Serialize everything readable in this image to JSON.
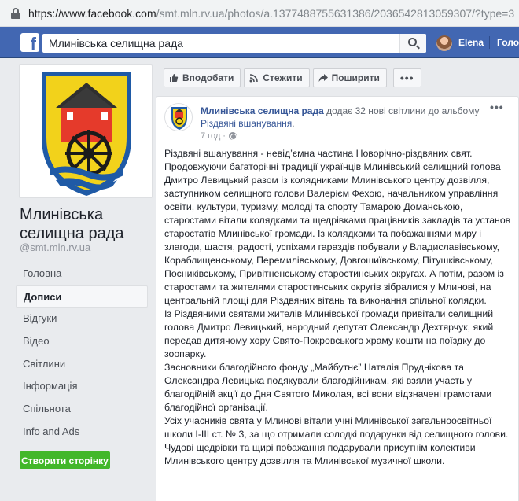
{
  "browser": {
    "url_main": "https://www.facebook.com",
    "url_rest": "/smt.mln.rv.ua/photos/a.1377488755631386/2036542813059307/?type=3"
  },
  "header": {
    "logo": "f",
    "search_value": "Млинівська селищна рада",
    "user_name": "Elena",
    "home_label": "Головна"
  },
  "page": {
    "name": "Млинівська селищна рада",
    "handle": "@smt.mln.rv.ua"
  },
  "nav": [
    {
      "label": "Головна",
      "active": false
    },
    {
      "label": "Дописи",
      "active": true
    },
    {
      "label": "Відгуки",
      "active": false
    },
    {
      "label": "Відео",
      "active": false
    },
    {
      "label": "Світлини",
      "active": false
    },
    {
      "label": "Інформація",
      "active": false
    },
    {
      "label": "Спільнота",
      "active": false
    },
    {
      "label": "Info and Ads",
      "active": false
    }
  ],
  "create_page_label": "Створити сторінку",
  "actions": {
    "like": "Вподобати",
    "follow": "Стежити",
    "share": "Поширити",
    "more": "•••"
  },
  "post": {
    "author": "Млинівська селищна рада",
    "action_text": " додає 32 нові світлини до альбому ",
    "album": "Різдвяні вшанування",
    "album_suffix": ".",
    "time": "7 год ·",
    "menu": "•••",
    "text": "Різдвяні вшанування - невід’ємна частина Новорічно-різдвяних свят.\nПродовжуючи багаторічні традиції українців Млинівський селищний голова Дмитро Левицький разом із колядниками Млинівського центру дозвілля, заступником селищного голови Валерієм Фехою, начальником управління освіти, культури, туризму, молоді та спорту Тамарою Доманською, старостами вітали колядками та щедрівками працівників закладів та установ старостатів Млинівської громади. Із колядками та побажаннями миру і злагоди, щастя, радості, успіхами гараздів побували у Владиславівському, Кораблищенському, Перемилівському, Довгошиївському, Пітушківському, Посниківському, Привітненському старостинських округах. А потім, разом із старостами та жителями старостинських округів зібралися у Млинові, на центральній площі для Різдвяних вітань та виконання спільної колядки.\nІз Різдвяними святами жителів Млинівської громади привітали селищний голова Дмитро Левицький, народний депутат Олександр Дехтярчук, який передав дитячому хору Свято-Покровського храму кошти на поїздку до зоопарку.\nЗасновники благодійного фонду „Майбутнє” Наталія Пруднікова та Олександра Левицька подякували благодійникам, які взяли участь у благодійній акції до Дня Святого Миколая, всі вони відзначені грамотами благодійної організації.\nУсіх учасників свята у Млинові вітали учні Млинівської загальноосвітньої школи І-ІІІ ст. № 3, за що отримали солодкі подарунки від селищного голови.\nЧудові щедрівки та щирі побажання подарували присутнім колективи Млинівського центру дозвілля та Млинівської музичної школи."
  },
  "colors": {
    "fb_blue": "#4267b2",
    "link": "#385898",
    "green": "#42b72a"
  }
}
